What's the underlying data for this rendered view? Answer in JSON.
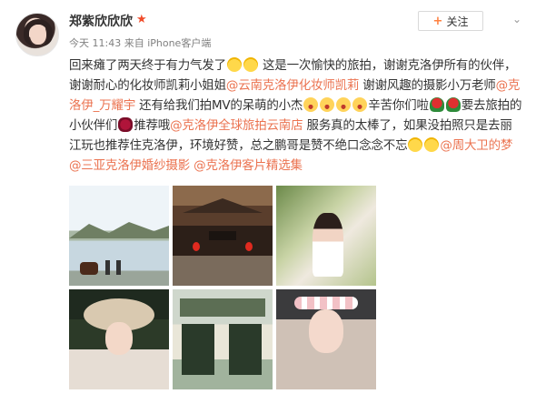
{
  "post": {
    "username": "郑紫欣欣欣",
    "badge": "★",
    "meta": "今天 11:43 来自 iPhone客户端",
    "follow_label": "关注",
    "follow_plus": "+",
    "chevron": "⌄",
    "text": {
      "s1": "回来瘫了两天终于有力气发了",
      "s2": " 这是一次愉快的旅拍，谢谢克洛伊所有的伙伴，谢谢耐心的化妆师凯莉小姐姐",
      "m1": "@云南克洛伊化妆师凯莉",
      "s3": " 谢谢风趣的摄影小万老师",
      "m2": "@克洛伊_万耀宇",
      "s4": " 还有给我们拍MV的呆萌的小杰",
      "s5": "辛苦你们啦",
      "s6": "要去旅拍的小伙伴们",
      "s7": "推荐哦",
      "m3": "@克洛伊全球旅拍云南店",
      "s8": " 服务真的太棒了，如果没拍照只是去丽江玩也推荐住克洛伊，环境好赞，总之鹏哥是赞不绝口念念不忘",
      "m4": "@周大卫的梦",
      "m5": "@三亚克洛伊婚纱摄影",
      "m6": "@克洛伊客片精选集"
    },
    "photos": [
      {
        "name": "lake-horse-photo"
      },
      {
        "name": "courtyard-lanterns-photo"
      },
      {
        "name": "girl-kiss-flowers-photo"
      },
      {
        "name": "straw-hat-portrait-photo"
      },
      {
        "name": "green-doors-street-photo"
      },
      {
        "name": "flower-crown-portrait-photo"
      }
    ],
    "colors": {
      "link": "#eb7350",
      "badge": "#f04b2a",
      "follow_plus": "#ff8140"
    }
  }
}
